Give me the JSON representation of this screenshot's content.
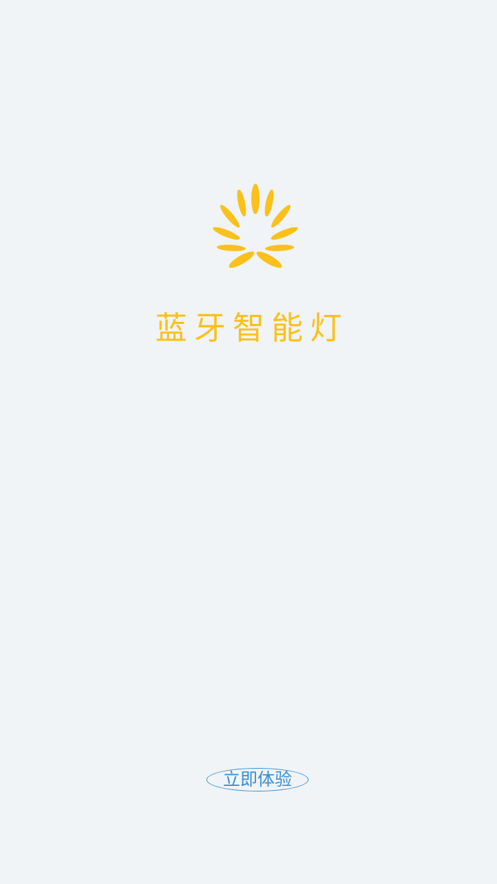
{
  "app": {
    "title": "蓝牙智能灯",
    "logo_icon": "lotus-flower-icon"
  },
  "start_button": {
    "label": "立即体验"
  },
  "colors": {
    "background": "#f0f4f7",
    "brand_yellow": "#fbc11a",
    "button_blue": "#3a8fd0"
  }
}
